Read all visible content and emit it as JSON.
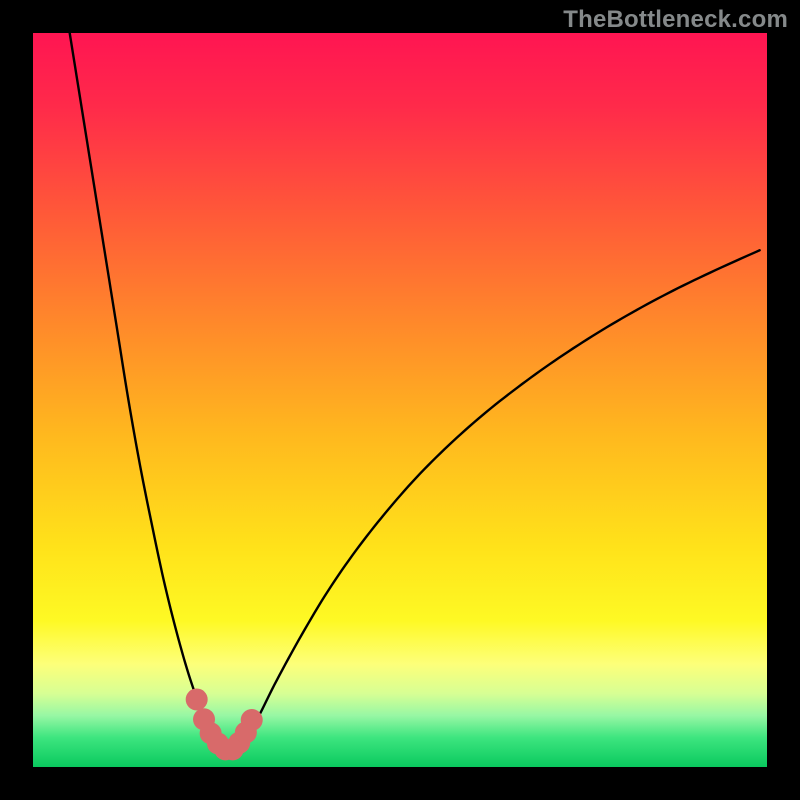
{
  "watermark": "TheBottleneck.com",
  "chart_data": {
    "type": "line",
    "title": "",
    "xlabel": "",
    "ylabel": "",
    "xlim": [
      0,
      100
    ],
    "ylim": [
      0,
      100
    ],
    "grid": false,
    "note": "y = bottleneck_percent; x = relative_component_strength; minimum ≈ 0 at x ≈ 26",
    "series": [
      {
        "name": "bottleneck-curve",
        "x": [
          5.0,
          6.6,
          8.2,
          9.8,
          11.4,
          13.0,
          14.6,
          16.2,
          17.8,
          19.4,
          21.0,
          22.6,
          23.5,
          24.5,
          25.5,
          26.5,
          27.5,
          28.5,
          29.5,
          31.0,
          33.2,
          36.6,
          40.2,
          44.0,
          48.0,
          52.2,
          56.6,
          61.2,
          66.0,
          71.0,
          76.2,
          81.6,
          87.2,
          93.0,
          99.0
        ],
        "y": [
          100.0,
          90.0,
          80.0,
          70.0,
          60.0,
          50.0,
          41.0,
          33.0,
          25.5,
          19.0,
          13.3,
          8.5,
          6.2,
          4.4,
          3.0,
          2.2,
          2.3,
          3.1,
          4.6,
          7.4,
          11.8,
          18.0,
          24.0,
          29.5,
          34.6,
          39.4,
          43.8,
          47.9,
          51.7,
          55.3,
          58.7,
          61.9,
          64.9,
          67.7,
          70.4
        ]
      }
    ],
    "markers": {
      "name": "optimal-region",
      "color": "#d86a6a",
      "x": [
        22.3,
        23.3,
        24.2,
        25.2,
        26.2,
        27.2,
        28.1,
        29.0,
        29.8
      ],
      "y": [
        9.2,
        6.5,
        4.6,
        3.2,
        2.4,
        2.4,
        3.3,
        4.7,
        6.4
      ]
    },
    "gradient_stops": [
      {
        "offset": 0.0,
        "color": "#ff1552"
      },
      {
        "offset": 0.1,
        "color": "#ff2a4a"
      },
      {
        "offset": 0.25,
        "color": "#ff5a38"
      },
      {
        "offset": 0.4,
        "color": "#ff8a2a"
      },
      {
        "offset": 0.55,
        "color": "#ffb91e"
      },
      {
        "offset": 0.7,
        "color": "#ffe21a"
      },
      {
        "offset": 0.8,
        "color": "#fef924"
      },
      {
        "offset": 0.86,
        "color": "#fdff7a"
      },
      {
        "offset": 0.9,
        "color": "#d7ff94"
      },
      {
        "offset": 0.93,
        "color": "#97f7a4"
      },
      {
        "offset": 0.96,
        "color": "#3de57f"
      },
      {
        "offset": 1.0,
        "color": "#0ac95e"
      }
    ]
  }
}
